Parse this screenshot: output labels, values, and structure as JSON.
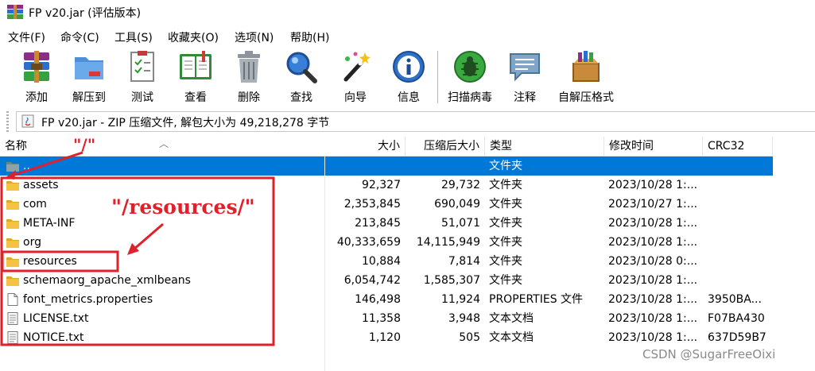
{
  "window": {
    "title": "FP v20.jar (评估版本)"
  },
  "menu": [
    "文件(F)",
    "命令(C)",
    "工具(S)",
    "收藏夹(O)",
    "选项(N)",
    "帮助(H)"
  ],
  "toolbar": [
    {
      "label": "添加",
      "icon": "add-archive-icon"
    },
    {
      "label": "解压到",
      "icon": "extract-to-icon"
    },
    {
      "label": "测试",
      "icon": "test-icon"
    },
    {
      "label": "查看",
      "icon": "view-book-icon"
    },
    {
      "label": "删除",
      "icon": "trash-icon"
    },
    {
      "label": "查找",
      "icon": "magnifier-icon"
    },
    {
      "label": "向导",
      "icon": "wizard-wand-icon"
    },
    {
      "label": "信息",
      "icon": "info-icon"
    },
    {
      "label": "扫描病毒",
      "icon": "virus-scan-icon"
    },
    {
      "label": "注释",
      "icon": "comment-icon"
    },
    {
      "label": "自解压格式",
      "icon": "sfx-box-icon"
    }
  ],
  "address": {
    "text": "FP v20.jar - ZIP 压缩文件, 解包大小为 49,218,278 字节"
  },
  "columns": {
    "name": "名称",
    "size": "大小",
    "packed": "压缩后大小",
    "type": "类型",
    "modified": "修改时间",
    "crc": "CRC32"
  },
  "rows": [
    {
      "name": "..",
      "size": "",
      "packed": "",
      "type": "文件夹",
      "modified": "",
      "crc": "",
      "icon": "folder-up-icon",
      "selected": true
    },
    {
      "name": "assets",
      "size": "92,327",
      "packed": "29,732",
      "type": "文件夹",
      "modified": "2023/10/28 1:...",
      "crc": "",
      "icon": "folder-icon"
    },
    {
      "name": "com",
      "size": "2,353,845",
      "packed": "690,049",
      "type": "文件夹",
      "modified": "2023/10/27 1:...",
      "crc": "",
      "icon": "folder-icon"
    },
    {
      "name": "META-INF",
      "size": "213,845",
      "packed": "51,071",
      "type": "文件夹",
      "modified": "2023/10/28 1:...",
      "crc": "",
      "icon": "folder-icon"
    },
    {
      "name": "org",
      "size": "40,333,659",
      "packed": "14,115,949",
      "type": "文件夹",
      "modified": "2023/10/28 1:...",
      "crc": "",
      "icon": "folder-icon"
    },
    {
      "name": "resources",
      "size": "10,884",
      "packed": "7,814",
      "type": "文件夹",
      "modified": "2023/10/28 0:...",
      "crc": "",
      "icon": "folder-icon"
    },
    {
      "name": "schemaorg_apache_xmlbeans",
      "size": "6,054,742",
      "packed": "1,585,307",
      "type": "文件夹",
      "modified": "2023/10/28 1:...",
      "crc": "",
      "icon": "folder-icon"
    },
    {
      "name": "font_metrics.properties",
      "size": "146,498",
      "packed": "11,924",
      "type": "PROPERTIES 文件",
      "modified": "2023/10/28 1:...",
      "crc": "3950BA...",
      "icon": "file-icon"
    },
    {
      "name": "LICENSE.txt",
      "size": "11,358",
      "packed": "3,948",
      "type": "文本文档",
      "modified": "2023/10/28 1:...",
      "crc": "F07BA430",
      "icon": "text-file-icon"
    },
    {
      "name": "NOTICE.txt",
      "size": "1,120",
      "packed": "505",
      "type": "文本文档",
      "modified": "2023/10/28 1:...",
      "crc": "637D59B7",
      "icon": "text-file-icon"
    }
  ],
  "annotations": {
    "root": "\"/\"",
    "resources": "\"/resources/\""
  },
  "watermark": "CSDN @SugarFreeOixi",
  "colors": {
    "selection": "#0078d7",
    "annotation": "#e0202a",
    "folder": "#f5c342"
  }
}
